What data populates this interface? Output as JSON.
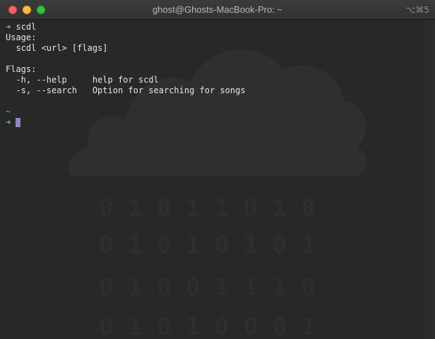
{
  "window": {
    "title": "ghost@Ghosts-MacBook-Pro: ~",
    "shortcut": "⌥⌘5"
  },
  "terminal": {
    "prompt_symbol": "➜",
    "command": "scdl",
    "usage_header": "Usage:",
    "usage_line": "  scdl <url> [flags]",
    "flags_header": "Flags:",
    "flags": [
      {
        "flag": "  -h, --help     ",
        "description": "help for scdl"
      },
      {
        "flag": "  -s, --search   ",
        "description": "Option for searching for songs"
      }
    ],
    "cwd": "~"
  },
  "colors": {
    "prompt": "#5fd75f",
    "cwd": "#5fafd7",
    "cursor": "#8f86c8",
    "background": "#282828",
    "text": "#e6e6e6"
  },
  "icons": {
    "watermark": "cloud-raining-binary-icon"
  }
}
